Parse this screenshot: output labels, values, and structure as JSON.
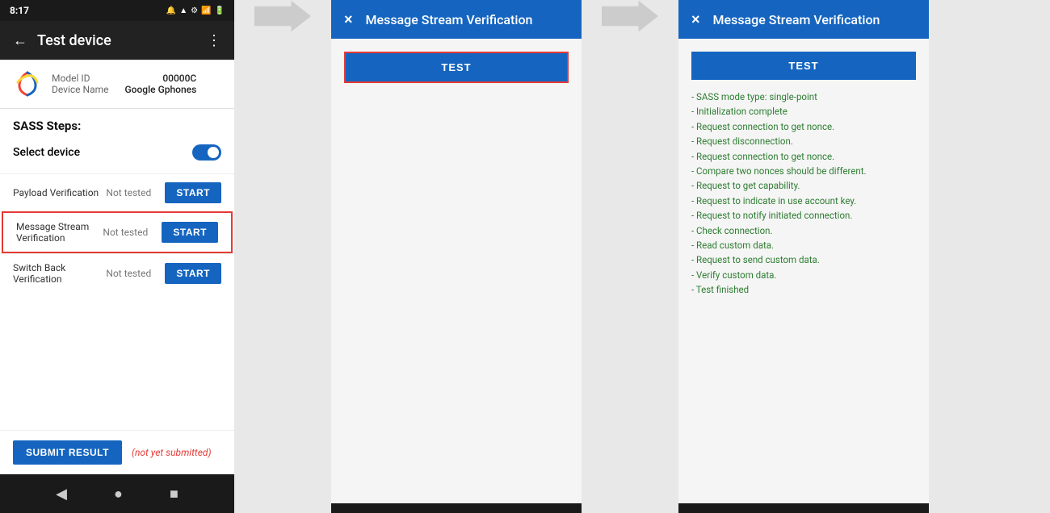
{
  "phone": {
    "status_time": "8:17",
    "app_title": "Test device",
    "model_id_label": "Model ID",
    "model_id_value": "00000C",
    "device_name_label": "Device Name",
    "device_name_value": "Google Gphones",
    "sass_title": "SASS Steps:",
    "select_device_label": "Select device",
    "steps": [
      {
        "name": "Payload Verification",
        "status": "Not tested",
        "btn": "START",
        "highlighted": false
      },
      {
        "name": "Message Stream Verification",
        "status": "Not tested",
        "btn": "START",
        "highlighted": true
      },
      {
        "name": "Switch Back Verification",
        "status": "Not tested",
        "btn": "START",
        "highlighted": false
      }
    ],
    "submit_btn": "SUBMIT RESULT",
    "not_submitted": "(not yet submitted)",
    "nav": [
      "◀",
      "●",
      "■"
    ]
  },
  "dialog1": {
    "title": "Message Stream Verification",
    "close_label": "×",
    "test_btn": "TEST",
    "highlighted": true
  },
  "dialog2": {
    "title": "Message Stream Verification",
    "close_label": "×",
    "test_btn": "TEST",
    "log_lines": [
      "- SASS mode type: single-point",
      "- Initialization complete",
      "- Request connection to get nonce.",
      "- Request disconnection.",
      "- Request connection to get nonce.",
      "- Compare two nonces should be different.",
      "- Request to get capability.",
      "- Request to indicate in use account key.",
      "- Request to notify initiated connection.",
      "- Check connection.",
      "- Read custom data.",
      "- Request to send custom data.",
      "- Verify custom data.",
      "- Test finished"
    ]
  }
}
